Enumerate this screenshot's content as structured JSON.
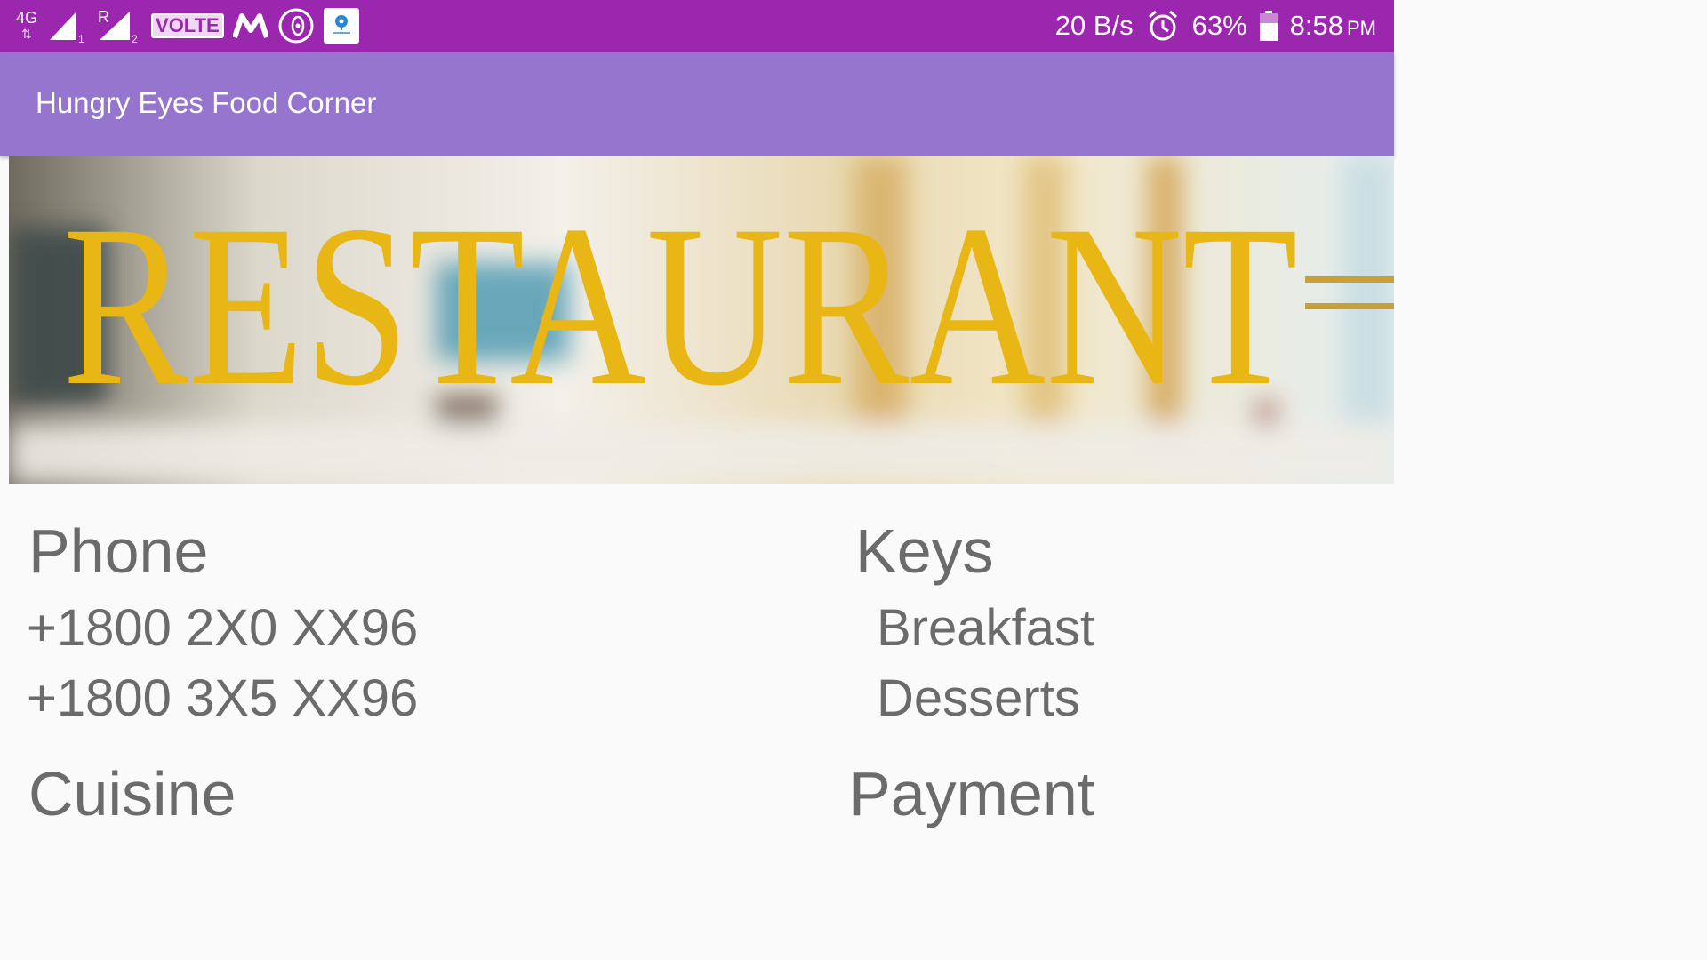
{
  "status_bar": {
    "network_type": "4G",
    "roaming_indicator": "R",
    "sim1_label": "1",
    "sim2_label": "2",
    "volte_label": "VOLTE",
    "data_speed": "20 B/s",
    "battery_percent": "63%",
    "battery_level": 0.63,
    "time": "8:58",
    "ampm": "PM",
    "icons": [
      "4g-data-icon",
      "signal-icon",
      "signal-roaming-icon",
      "volte-icon",
      "m-app-icon",
      "dnd-icon",
      "sbi-app-icon",
      "alarm-icon",
      "battery-icon"
    ]
  },
  "toolbar": {
    "title": "Hungry Eyes Food Corner"
  },
  "hero": {
    "banner_text": "RESTAURANT",
    "banner_color": "#e8b615"
  },
  "details": {
    "phone_title": "Phone",
    "phones": [
      "+1800 2X0 XX96",
      "+1800 3X5 XX96"
    ],
    "keys_title": "Keys",
    "keys": [
      "Breakfast",
      "Desserts"
    ],
    "cuisine_title": "Cuisine",
    "payment_title": "Payment"
  },
  "colors": {
    "status_bar": "#9b27af",
    "toolbar": "#9575cd",
    "text": "#6b6b6b",
    "background": "#fafafa"
  }
}
